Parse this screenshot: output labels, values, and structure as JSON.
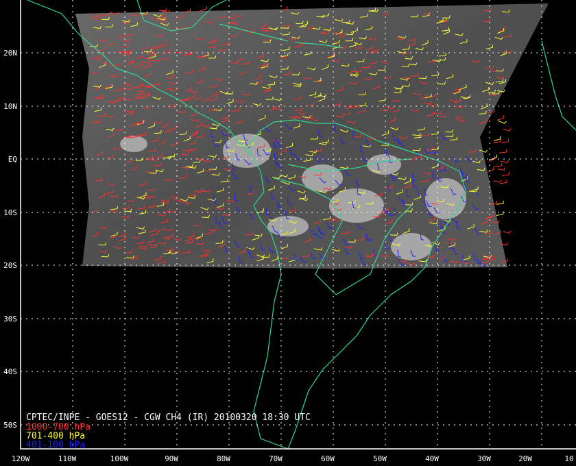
{
  "map": {
    "title": "CPTEC/INPE - GOES12 - CGW CH4 (IR) 20100320 18:30 UTC",
    "legend": [
      {
        "label": "1000-700 hPa",
        "color": "#ff3030"
      },
      {
        "label": "701-400 hPa",
        "color": "#ffff30"
      },
      {
        "label": "401-100 hPa",
        "color": "#2020ff"
      }
    ],
    "lon_ticks": [
      "120W",
      "110W",
      "100W",
      "90W",
      "80W",
      "70W",
      "60W",
      "50W",
      "40W",
      "30W",
      "20W",
      "10"
    ],
    "lat_ticks": [
      "20N",
      "10N",
      "EQ",
      "10S",
      "20S",
      "30S",
      "40S",
      "50S"
    ],
    "colors": {
      "coast": "#30d890",
      "grid": "#ffffff",
      "background": "#000000"
    }
  }
}
